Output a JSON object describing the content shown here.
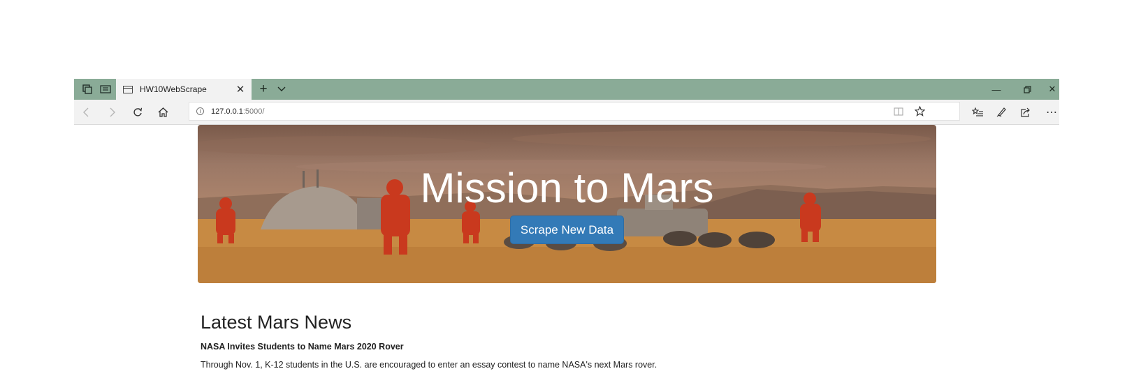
{
  "browser": {
    "tab_title": "HW10WebScrape",
    "new_tab_glyph": "+",
    "url_host": "127.0.0.1",
    "url_path": ":5000/",
    "tab_bar_color": "#8aab97",
    "icons": {
      "tab_set_aside": "tabs-aside-icon",
      "tab_preview": "tab-preview-icon",
      "page": "page-icon",
      "close_tab": "close-icon",
      "back": "back-arrow-icon",
      "forward": "forward-arrow-icon",
      "refresh": "refresh-icon",
      "home": "home-icon",
      "site_info": "info-icon",
      "reading_view": "reading-view-icon",
      "favorite": "star-icon",
      "favorites_list": "favorites-list-icon",
      "notes": "pen-icon",
      "share": "share-icon",
      "more": "more-icon",
      "minimize": "minimize-icon",
      "restore": "restore-icon",
      "close_window": "close-window-icon"
    }
  },
  "hero": {
    "title": "Mission to Mars",
    "button_label": "Scrape New Data",
    "button_color": "#337ab7"
  },
  "news": {
    "heading": "Latest Mars News",
    "title": "NASA Invites Students to Name Mars 2020 Rover",
    "paragraph": "Through Nov. 1, K-12 students in the U.S. are encouraged to enter an essay contest to name NASA's next Mars rover."
  }
}
